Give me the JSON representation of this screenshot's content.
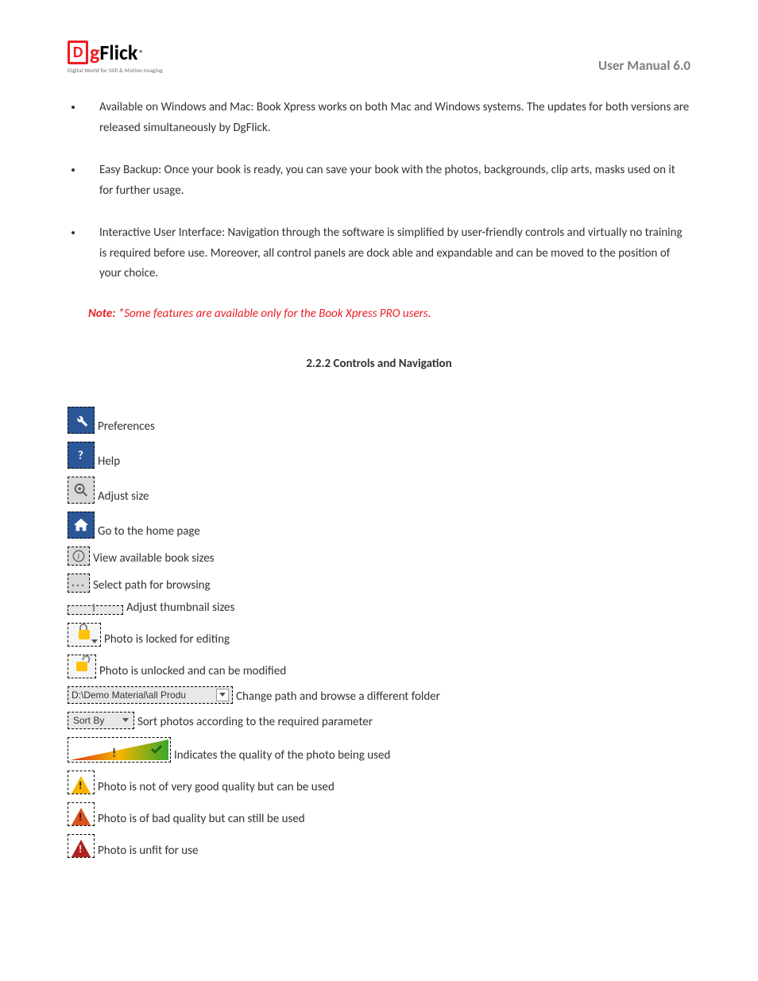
{
  "header": {
    "logo_text_g": "g",
    "logo_text_flick": "Flick",
    "logo_reg": "®",
    "tagline": "Digital World for Still & Motion Imaging",
    "manual_title": "User Manual 6.0"
  },
  "bullets": [
    "Available on Windows and Mac: Book Xpress works on both Mac and Windows systems. The updates for both versions are released simultaneously by DgFlick.",
    "Easy Backup: Once your book is ready, you can save your book with the photos, backgrounds, clip arts, masks used on it for further usage.",
    "Interactive User Interface: Navigation through the software is simplified by user-friendly controls and virtually no training is required before use. Moreover, all control panels are dock able and expandable and can be moved to the position of your choice."
  ],
  "note": {
    "label": "Note: ",
    "text": "*Some features are available only for the Book Xpress PRO users."
  },
  "section_title": "2.2.2 Controls and Navigation",
  "controls": {
    "preferences": "Preferences",
    "help": "Help",
    "adjust_size": "Adjust size",
    "home": "Go to the home page",
    "view_sizes": "View available book sizes",
    "select_path": "Select path for browsing",
    "adjust_thumbs": "Adjust thumbnail sizes",
    "locked": "Photo is locked for editing",
    "unlocked": "Photo is unlocked and can be modified",
    "path_value": "D:\\Demo Material\\all Produ",
    "change_path": "Change path and browse a different folder",
    "sort_value": "Sort By",
    "sort_desc": "Sort photos according to the required parameter",
    "quality_indicator": "Indicates the quality of the photo being used",
    "warn_yellow": "Photo is not of very good quality but can be used",
    "warn_orange": "Photo is of bad quality but can still be used",
    "warn_red": "Photo is unfit for use"
  }
}
